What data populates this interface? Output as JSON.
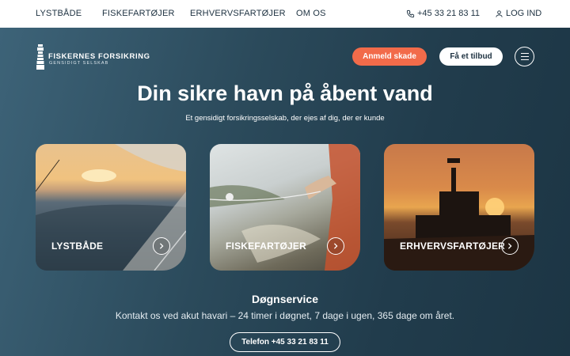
{
  "nav": {
    "items": [
      {
        "label": "LYSTBÅDE"
      },
      {
        "label": "FISKEFARTØJER"
      },
      {
        "label": "ERHVERVSFARTØJER"
      },
      {
        "label": "OM OS"
      }
    ],
    "phone": "+45 33 21 83 11",
    "login": "LOG IND"
  },
  "header": {
    "logo_name": "FISKERNES FORSIKRING",
    "logo_tagline": "GENSIDIGT SELSKAB",
    "claim_button": "Anmeld skade",
    "offer_button": "Få et tilbud"
  },
  "hero": {
    "title": "Din sikre havn på åbent vand",
    "subtitle": "Et gensidigt forsikringsselskab, der ejes af dig, der er kunde"
  },
  "cards": [
    {
      "label": "LYSTBÅDE"
    },
    {
      "label": "FISKEFARTØJER"
    },
    {
      "label": "ERHVERVSFARTØJER"
    }
  ],
  "service": {
    "title": "Døgnservice",
    "text": "Kontakt os ved akut havari – 24 timer i døgnet, 7 dage i ugen, 365 dage om året.",
    "phone_button": "Telefon +45 33 21 83 11"
  },
  "colors": {
    "accent": "#f26b4a",
    "hero_bg": "#2b4a5b",
    "text_dark": "#1d3140"
  },
  "icons": [
    "phone-icon",
    "user-icon",
    "menu-icon",
    "arrow-right-icon",
    "lighthouse-icon"
  ]
}
